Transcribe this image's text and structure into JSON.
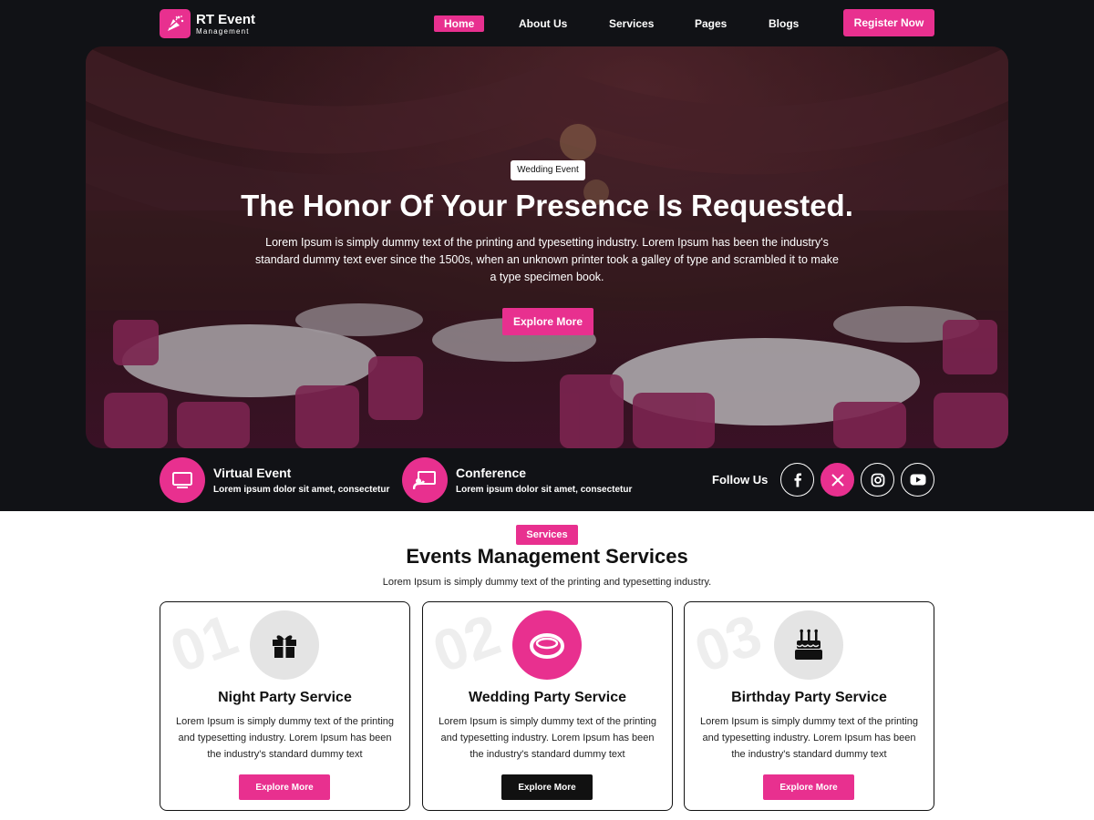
{
  "brand": {
    "title": "RT Event",
    "subtitle": "Management",
    "icon": "party-popper-icon"
  },
  "nav": {
    "items": [
      "Home",
      "About Us",
      "Services",
      "Pages",
      "Blogs"
    ],
    "active": "Home"
  },
  "header": {
    "register_label": "Register Now"
  },
  "hero": {
    "tag": "Wedding Event",
    "title": "The Honor Of Your Presence Is Requested.",
    "description": "Lorem Ipsum is simply dummy text of the printing and typesetting industry. Lorem Ipsum has been the industry's standard dummy text ever since the 1500s, when an unknown printer took a galley of type and scrambled it to make a type specimen book.",
    "button_label": "Explore More"
  },
  "features": [
    {
      "title": "Virtual Event",
      "description": "Lorem ipsum dolor sit amet, consectetur",
      "icon": "monitor-icon"
    },
    {
      "title": "Conference",
      "description": "Lorem ipsum dolor sit amet, consectetur",
      "icon": "presentation-icon"
    }
  ],
  "social": {
    "label": "Follow Us",
    "icons": [
      "facebook-icon",
      "x-icon",
      "instagram-icon",
      "youtube-icon"
    ],
    "active": "x-icon"
  },
  "services": {
    "tag": "Services",
    "title": "Events Management Services",
    "description": "Lorem Ipsum is simply dummy text of the printing and typesetting industry.",
    "cards": [
      {
        "number": "01",
        "title": "Night Party Service",
        "description": "Lorem Ipsum is simply dummy text of the printing and typesetting industry. Lorem Ipsum has been the industry's standard dummy text",
        "button_label": "Explore More",
        "icon": "gift-icon"
      },
      {
        "number": "02",
        "title": "Wedding Party Service",
        "description": "Lorem Ipsum is simply dummy text of the printing and typesetting industry. Lorem Ipsum has been the industry's standard dummy text",
        "button_label": "Explore More",
        "icon": "ring-icon"
      },
      {
        "number": "03",
        "title": "Birthday Party Service",
        "description": "Lorem Ipsum is simply dummy text of the printing and typesetting industry. Lorem Ipsum has been the industry's standard dummy text",
        "button_label": "Explore More",
        "icon": "cake-icon"
      }
    ]
  },
  "colors": {
    "accent": "#e8308f",
    "dark": "#111216",
    "text": "#111111"
  }
}
